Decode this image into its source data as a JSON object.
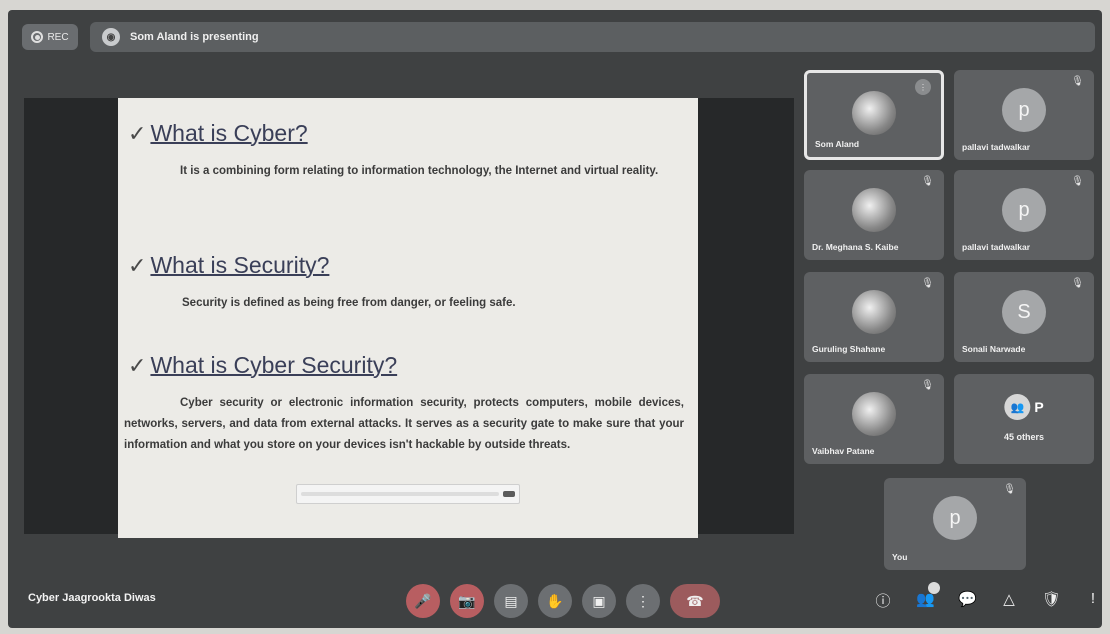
{
  "topbar": {
    "rec_label": "REC",
    "presenting_text": "Som Aland is presenting"
  },
  "slide": {
    "check_glyph": "✓",
    "sections": [
      {
        "heading": "What is Cyber?",
        "body": "It is a combining form relating to information technology, the Internet and virtual reality."
      },
      {
        "heading": "What is Security?",
        "body": "Security is defined as being free from danger, or feeling safe."
      },
      {
        "heading": "What is Cyber Security?",
        "body": "Cyber security or electronic information security, protects computers, mobile devices, networks, servers, and data from external attacks. It serves as a security gate to make sure that your information and what you store on your devices isn't hackable by outside threats."
      }
    ]
  },
  "participants": [
    {
      "name": "Som Aland",
      "avatar": "",
      "active": true
    },
    {
      "name": "pallavi tadwalkar",
      "avatar": "p"
    },
    {
      "name": "Dr. Meghana S. Kaibe",
      "avatar": ""
    },
    {
      "name": "pallavi tadwalkar",
      "avatar": "p"
    },
    {
      "name": "Guruling Shahane",
      "avatar": ""
    },
    {
      "name": "Sonali Narwade",
      "avatar": "S"
    },
    {
      "name": "Vaibhav Patane",
      "avatar": ""
    },
    {
      "name": "You",
      "avatar": "p"
    }
  ],
  "others_tile": {
    "label": "45 others",
    "avatar": "P"
  },
  "bottombar": {
    "meeting_title": "Cyber Jaagrookta Diwas"
  },
  "icons": {
    "mic": "mic-off-icon",
    "camera": "camera-off-icon",
    "captions": "captions-icon",
    "hand": "raise-hand-icon",
    "present": "present-screen-icon",
    "more": "more-options-icon",
    "hangup": "end-call-icon",
    "info": "info-icon",
    "people": "people-icon",
    "chat": "chat-icon",
    "activities": "activities-icon",
    "host": "host-controls-icon",
    "alert": "alert-icon"
  },
  "colors": {
    "background": "#3f4142",
    "tile": "#5e6062",
    "slide": "#ecebe7",
    "heading": "#3a3f58",
    "hangup": "#9c5b5d"
  }
}
